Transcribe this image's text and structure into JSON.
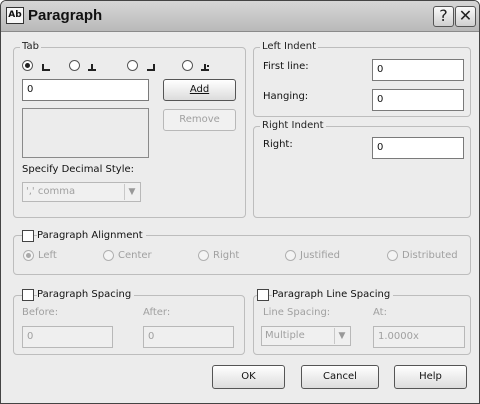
{
  "window": {
    "title": "Paragraph",
    "help_glyph": "?",
    "close_glyph": "✕",
    "app_icon_glyph": "Ab"
  },
  "tab": {
    "group_label": "Tab",
    "stops": [
      {
        "type": "left",
        "selected": true
      },
      {
        "type": "center",
        "selected": false
      },
      {
        "type": "right",
        "selected": false
      },
      {
        "type": "decimal",
        "selected": false
      }
    ],
    "input_value": "0",
    "add_label": "Add",
    "remove_label": "Remove",
    "decimal_style_label": "Specify Decimal Style:",
    "decimal_style_value": "',' comma"
  },
  "left_indent": {
    "group_label": "Left Indent",
    "first_line_label": "First line:",
    "first_line_value": "0",
    "hanging_label": "Hanging:",
    "hanging_value": "0"
  },
  "right_indent": {
    "group_label": "Right Indent",
    "right_label": "Right:",
    "right_value": "0"
  },
  "alignment": {
    "group_label": "Paragraph Alignment",
    "options": [
      "Left",
      "Center",
      "Right",
      "Justified",
      "Distributed"
    ]
  },
  "spacing": {
    "group_label": "Paragraph Spacing",
    "before_label": "Before:",
    "before_value": "0",
    "after_label": "After:",
    "after_value": "0"
  },
  "line_spacing": {
    "group_label": "Paragraph Line Spacing",
    "line_spacing_label": "Line Spacing:",
    "line_spacing_value": "Multiple",
    "at_label": "At:",
    "at_value": "1.0000x"
  },
  "buttons": {
    "ok": "OK",
    "cancel": "Cancel",
    "help": "Help"
  }
}
